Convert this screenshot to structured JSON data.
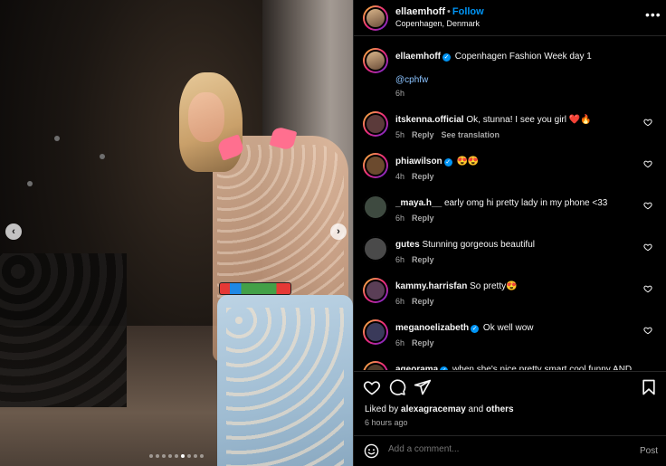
{
  "post": {
    "author": "ellaemhoff",
    "follow_label": "Follow",
    "location": "Copenhagen, Denmark",
    "more_label": "•••",
    "caption_user": "ellaemhoff",
    "caption_text": "Copenhagen Fashion Week day 1",
    "caption_tag": "@cphfw",
    "caption_time": "6h",
    "carousel": {
      "count": 9,
      "active_index": 5
    }
  },
  "comments": [
    {
      "user": "itskenna.official",
      "verified": false,
      "text": "Ok, stunna! I see you girl ❤️🔥",
      "time": "5h",
      "reply": "Reply",
      "extra": "See translation"
    },
    {
      "user": "phiawilson",
      "verified": true,
      "text": "😍😍",
      "time": "4h",
      "reply": "Reply",
      "extra": ""
    },
    {
      "user": "_maya.h__",
      "verified": false,
      "text": "early omg hi pretty lady in my phone <33",
      "time": "6h",
      "reply": "Reply",
      "extra": ""
    },
    {
      "user": "gutes",
      "verified": false,
      "text": "Stunning gorgeous beautiful",
      "time": "6h",
      "reply": "Reply",
      "extra": ""
    },
    {
      "user": "kammy.harrisfan",
      "verified": false,
      "text": "So pretty😍",
      "time": "6h",
      "reply": "Reply",
      "extra": ""
    },
    {
      "user": "meganoelizabeth",
      "verified": true,
      "text": "Ok well wow",
      "time": "6h",
      "reply": "Reply",
      "extra": ""
    },
    {
      "user": "ageorama",
      "verified": true,
      "text": "when she's nice pretty smart cool funny AND",
      "time": "",
      "reply": "",
      "extra": ""
    }
  ],
  "likes": {
    "prefix": "Liked by ",
    "user": "alexagracemay",
    "middle": " and ",
    "others": "others"
  },
  "post_time": "6 hours ago",
  "composer": {
    "placeholder": "Add a comment...",
    "post_label": "Post"
  },
  "icons": {
    "verified": "verified-badge-icon",
    "heart": "heart-icon",
    "comment": "comment-icon",
    "share": "share-icon",
    "save": "bookmark-icon",
    "emoji": "emoji-icon"
  },
  "colors": {
    "accent": "#0095f6",
    "background": "#000000",
    "muted": "#a8a8a8"
  }
}
